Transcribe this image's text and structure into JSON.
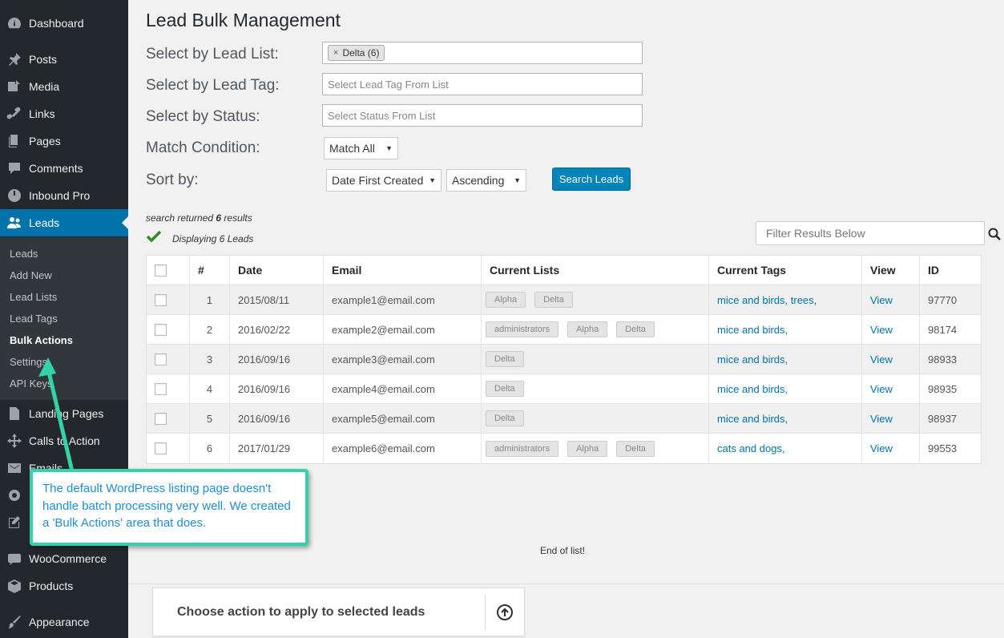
{
  "sidebar": {
    "items": [
      {
        "label": "Dashboard",
        "icon": "dashboard-icon"
      },
      {
        "label": "Posts",
        "icon": "pin-icon"
      },
      {
        "label": "Media",
        "icon": "media-icon"
      },
      {
        "label": "Links",
        "icon": "link-icon"
      },
      {
        "label": "Pages",
        "icon": "pages-icon"
      },
      {
        "label": "Comments",
        "icon": "comment-icon"
      },
      {
        "label": "Inbound Pro",
        "icon": "power-icon"
      },
      {
        "label": "Leads",
        "icon": "users-icon"
      },
      {
        "label": "Landing Pages",
        "icon": "document-icon"
      },
      {
        "label": "Calls to Action",
        "icon": "crosshair-icon"
      },
      {
        "label": "Emails",
        "icon": "envelope-icon"
      },
      {
        "label": "WooCommerce",
        "icon": "woo-icon"
      },
      {
        "label": "Products",
        "icon": "box-icon"
      },
      {
        "label": "Appearance",
        "icon": "brush-icon"
      }
    ],
    "submenu": [
      "Leads",
      "Add New",
      "Lead Lists",
      "Lead Tags",
      "Bulk Actions",
      "Settings",
      "API Keys"
    ]
  },
  "page": {
    "title": "Lead Bulk Management",
    "labels": {
      "lead_list": "Select by Lead List:",
      "lead_tag": "Select by Lead Tag:",
      "status": "Select by Status:",
      "match": "Match Condition:",
      "sort": "Sort by:"
    },
    "lead_list_chip": "Delta (6)",
    "lead_list_chip_remove": "×",
    "lead_tag_placeholder": "Select Lead Tag From List",
    "status_placeholder": "Select Status From List",
    "match_value": "Match All",
    "sort_field": "Date First Created",
    "sort_order": "Ascending",
    "search_button": "Search Leads",
    "results_prefix": "search returned ",
    "results_count": "6",
    "results_suffix": " results",
    "displaying": "Displaying 6 Leads",
    "filter_placeholder": "Filter Results Below",
    "end_of_list": "End of list!",
    "bulk_action_label": "Choose action to apply to selected leads"
  },
  "table": {
    "headers": [
      "#",
      "Date",
      "Email",
      "Current Lists",
      "Current Tags",
      "View",
      "ID"
    ],
    "rows": [
      {
        "num": "1",
        "date": "2015/08/11",
        "email": "example1@email.com",
        "lists": [
          "Alpha",
          "Delta"
        ],
        "tags": "mice and birds, trees,",
        "view": "View",
        "id": "97770"
      },
      {
        "num": "2",
        "date": "2016/02/22",
        "email": "example2@email.com",
        "lists": [
          "administrators",
          "Alpha",
          "Delta"
        ],
        "tags": "mice and birds,",
        "view": "View",
        "id": "98174"
      },
      {
        "num": "3",
        "date": "2016/09/16",
        "email": "example3@email.com",
        "lists": [
          "Delta"
        ],
        "tags": "mice and birds,",
        "view": "View",
        "id": "98933"
      },
      {
        "num": "4",
        "date": "2016/09/16",
        "email": "example4@email.com",
        "lists": [
          "Delta"
        ],
        "tags": "mice and birds,",
        "view": "View",
        "id": "98935"
      },
      {
        "num": "5",
        "date": "2016/09/16",
        "email": "example5@email.com",
        "lists": [
          "Delta"
        ],
        "tags": "mice and birds,",
        "view": "View",
        "id": "98937"
      },
      {
        "num": "6",
        "date": "2017/01/29",
        "email": "example6@email.com",
        "lists": [
          "administrators",
          "Alpha",
          "Delta"
        ],
        "tags": "cats and dogs,",
        "view": "View",
        "id": "99553"
      }
    ]
  },
  "callout": {
    "text": "The default WordPress listing page doesn't handle batch processing very well. We created a 'Bulk Actions' area that does."
  },
  "colors": {
    "sidebar_bg": "#23282d",
    "active_blue": "#0073aa",
    "button_blue": "#0085ba",
    "callout_border": "#33d3a9",
    "callout_text": "#1e8fd0",
    "check_green": "#2e8b2e"
  }
}
